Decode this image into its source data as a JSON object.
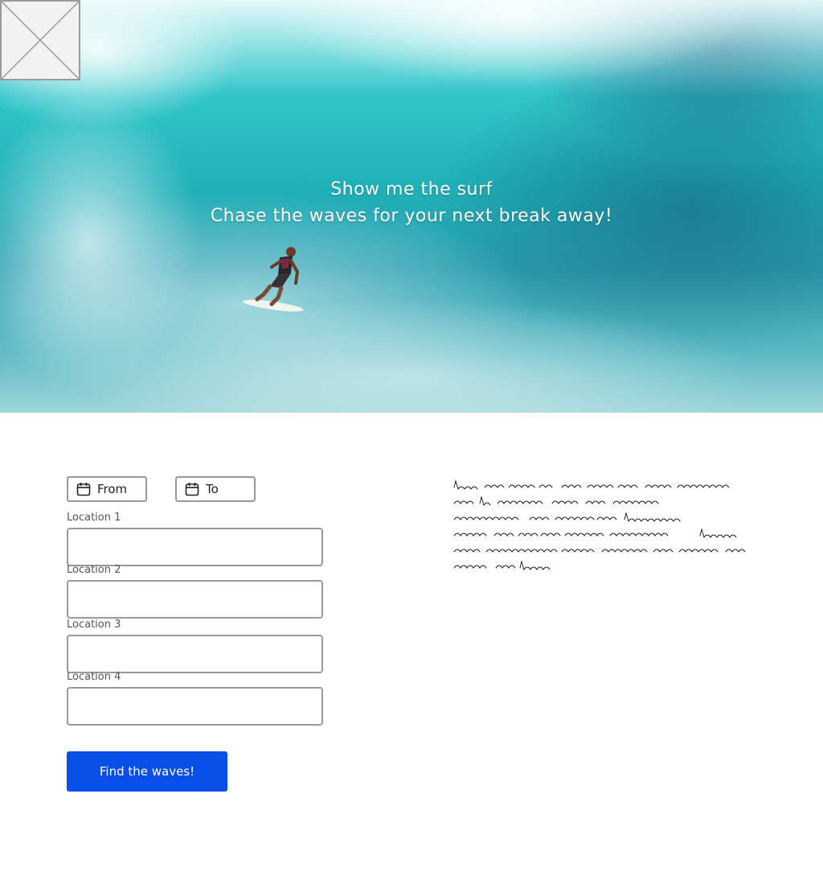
{
  "hero": {
    "title": "Show me the surf",
    "subtitle": "Chase the waves for your next break away!",
    "image": "surfer-on-wave-photo",
    "logo_placeholder": "image-placeholder"
  },
  "dates": {
    "from_label": "From",
    "to_label": "To",
    "icon": "calendar-icon"
  },
  "locations": [
    {
      "label": "Location 1",
      "value": ""
    },
    {
      "label": "Location 2",
      "value": ""
    },
    {
      "label": "Location 3",
      "value": ""
    },
    {
      "label": "Location 4",
      "value": ""
    }
  ],
  "actions": {
    "submit_label": "Find the waves!"
  },
  "colors": {
    "primary": "#0a4ee8",
    "border": "#9a9a9a",
    "hero_text": "#ffffff"
  }
}
